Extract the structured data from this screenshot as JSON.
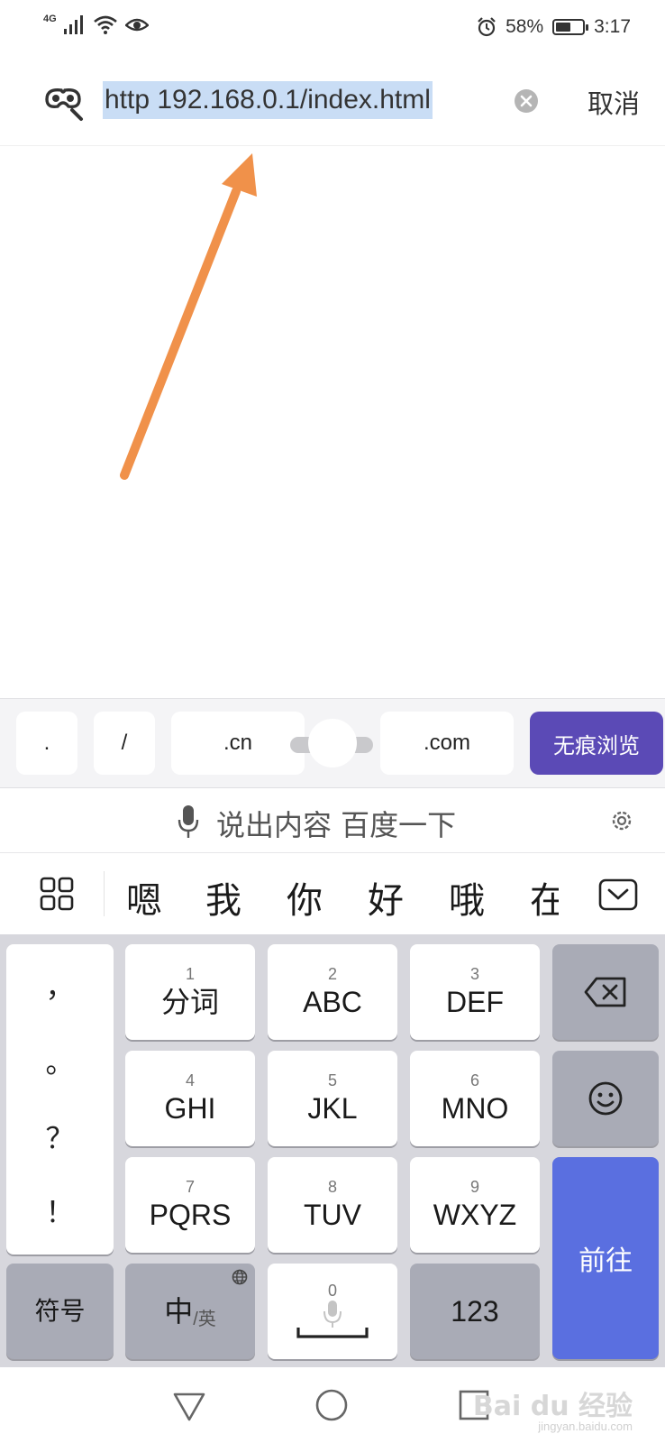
{
  "status_bar": {
    "network": "4G",
    "battery_percent": "58%",
    "battery_level": 0.58,
    "time": "3:17"
  },
  "address_bar": {
    "url": "http  192.168.0.1/index.html",
    "cancel_label": "取消"
  },
  "quick_keys": {
    "dot": ".",
    "slash": "/",
    "cn": ".cn",
    "com": ".com",
    "incognito": "无痕浏览"
  },
  "voice": {
    "prompt": "说出内容 百度一下"
  },
  "candidates": [
    "嗯",
    "我",
    "你",
    "好",
    "哦",
    "在"
  ],
  "keyboard": {
    "punctuation": [
      "，",
      "。",
      "？",
      "！"
    ],
    "keys": [
      {
        "num": "1",
        "label": "分词"
      },
      {
        "num": "2",
        "label": "ABC"
      },
      {
        "num": "3",
        "label": "DEF"
      },
      {
        "num": "4",
        "label": "GHI"
      },
      {
        "num": "5",
        "label": "JKL"
      },
      {
        "num": "6",
        "label": "MNO"
      },
      {
        "num": "7",
        "label": "PQRS"
      },
      {
        "num": "8",
        "label": "TUV"
      },
      {
        "num": "9",
        "label": "WXYZ"
      }
    ],
    "symbol": "符号",
    "lang_main": "中",
    "lang_sub": "/英",
    "space_num": "0",
    "num_key": "123",
    "go": "前往"
  },
  "watermark": {
    "brand": "Bai du 经验",
    "site": "jingyan.baidu.com"
  },
  "colors": {
    "incognito_bg": "#5b4ab6",
    "go_key_bg": "#5a6fe0",
    "url_selection": "#c9ddf5",
    "annotation_arrow": "#f0914a"
  }
}
